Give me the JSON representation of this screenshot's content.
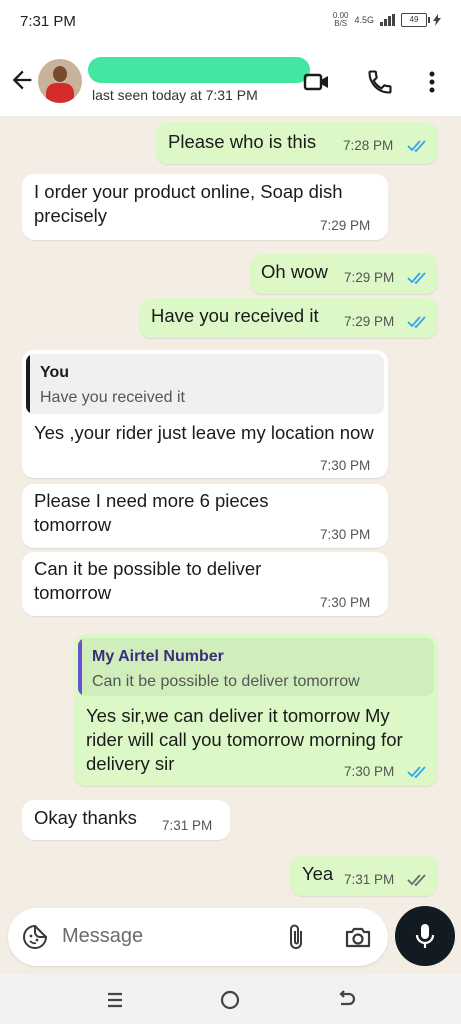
{
  "status_bar": {
    "time": "7:31 PM",
    "net_speed": "0.00",
    "net_unit": "B/S",
    "network_type": "4.5G",
    "battery": "49"
  },
  "header": {
    "last_seen": "last seen today at 7:31 PM"
  },
  "messages": [
    {
      "dir": "out",
      "text": "Please who is this",
      "time": "7:28 PM",
      "ticks": "read"
    },
    {
      "dir": "in",
      "text": "I order your product online, Soap dish precisely",
      "time": "7:29 PM"
    },
    {
      "dir": "out",
      "text": "Oh wow",
      "time": "7:29 PM",
      "ticks": "read"
    },
    {
      "dir": "out",
      "text": "Have you received it",
      "time": "7:29 PM",
      "ticks": "read"
    },
    {
      "dir": "in",
      "quote_name": "You",
      "quote_text": "Have you received it",
      "text": "Yes ,your rider just leave my location now",
      "time": "7:30 PM"
    },
    {
      "dir": "in",
      "text": "Please I need more 6 pieces tomorrow",
      "time": "7:30 PM"
    },
    {
      "dir": "in",
      "text": "Can it be possible to deliver tomorrow",
      "time": "7:30 PM"
    },
    {
      "dir": "out",
      "quote_name": "My Airtel Number",
      "quote_text": "Can it be possible to deliver tomorrow",
      "text": "Yes sir,we can deliver it tomorrow My rider will call you tomorrow morning for delivery sir",
      "time": "7:30 PM",
      "ticks": "read"
    },
    {
      "dir": "in",
      "text": "Okay thanks",
      "time": "7:31 PM"
    },
    {
      "dir": "out",
      "text": "Yea",
      "time": "7:31 PM",
      "ticks": "delivered"
    }
  ],
  "composer": {
    "placeholder": "Message"
  },
  "colors": {
    "read_ticks": "#34a3f0",
    "delivered_ticks": "#6b6b6b",
    "outgoing_bubble": "#dcf8c6",
    "incoming_bubble": "#ffffff",
    "name_redaction": "#43e6a1",
    "quote_you_bar": "#1b1b1b",
    "quote_airtel_bar": "#6a4fd1"
  },
  "icons": [
    "back-arrow-icon",
    "video-call-icon",
    "voice-call-icon",
    "more-options-icon",
    "sticker-icon",
    "attach-icon",
    "camera-icon",
    "mic-icon",
    "recents-icon",
    "home-icon",
    "nav-back-icon"
  ]
}
